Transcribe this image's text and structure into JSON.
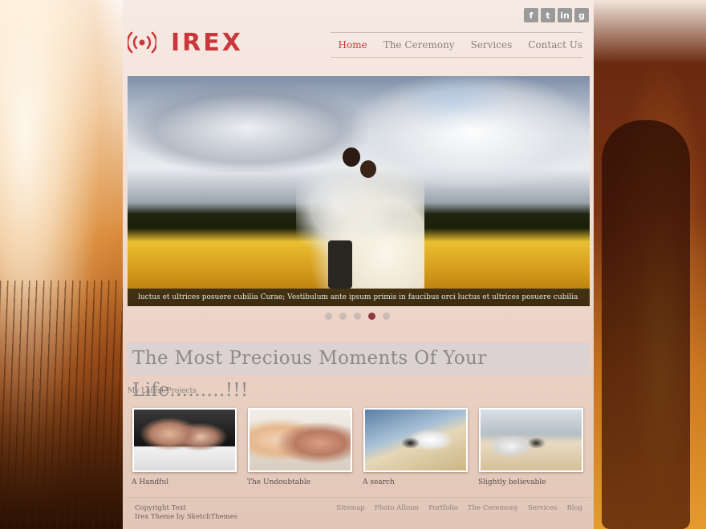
{
  "social": {
    "facebook": "f",
    "twitter": "t",
    "linkedin": "in",
    "google": "g"
  },
  "logo": {
    "text": "IREX",
    "icon": "radio-signal-icon"
  },
  "nav": {
    "items": [
      {
        "label": "Home",
        "active": true
      },
      {
        "label": "The Ceremony",
        "active": false
      },
      {
        "label": "Services",
        "active": false
      },
      {
        "label": "Contact Us",
        "active": false
      }
    ]
  },
  "slider": {
    "caption": "luctus et ultrices posuere cubilia Curae; Vestibulum ante ipsum primis in faucibus orci luctus et ultrices posuere cubilia Curae; Phasellus",
    "dot_count": 5,
    "active_dot": 4
  },
  "tagline": "The Most Precious Moments Of Your Life.........!!!",
  "projects": {
    "section_title": "My Latest Projects",
    "items": [
      {
        "label": "A Handful"
      },
      {
        "label": "The Undoubtable"
      },
      {
        "label": "A search"
      },
      {
        "label": "Slightly believable"
      }
    ]
  },
  "footer": {
    "copyright": "Copyright Text",
    "credit": "Irex Theme by SketchThemes",
    "links": [
      "Sitemap",
      "Photo Album",
      "Portfolio",
      "The Ceremony",
      "Services",
      "Blog"
    ]
  },
  "colors": {
    "accent": "#c9373b",
    "nav_text": "#8a7f7a",
    "active_dot": "#8a3a47"
  }
}
